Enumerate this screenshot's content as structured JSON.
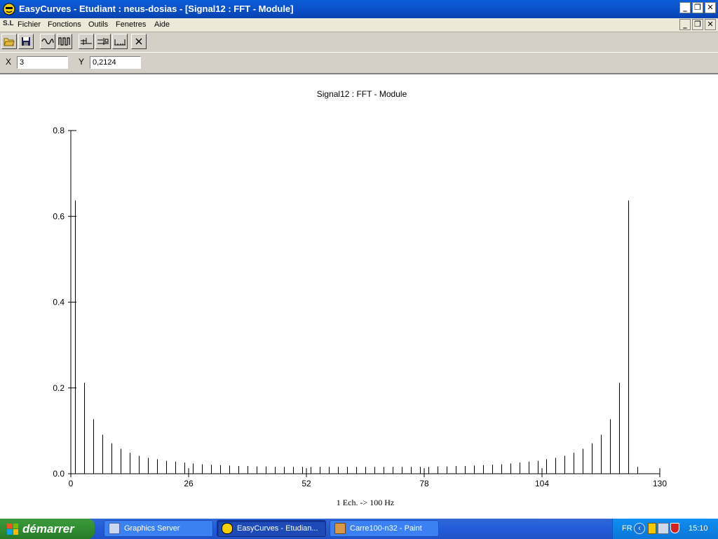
{
  "window": {
    "title": "EasyCurves - Etudiant : neus-dosias - [Signal12 : FFT - Module]",
    "controls": {
      "minimize": "_",
      "restore": "❐",
      "close": "✕"
    }
  },
  "menu": {
    "icon_text": "S.L",
    "items": [
      "Fichier",
      "Fonctions",
      "Outils",
      "Fenetres",
      "Aide"
    ]
  },
  "toolbar": {
    "buttons": [
      "open-folder-icon",
      "save-icon",
      "sine-wave-icon",
      "square-wave-icon",
      "measure-horizontal-icon",
      "measure-cursor-icon",
      "baseline-icon",
      "close-icon"
    ]
  },
  "coords": {
    "x_label": "X",
    "x_value": "3",
    "y_label": "Y",
    "y_value": "0,2124"
  },
  "chart_data": {
    "type": "bar",
    "style": "stem",
    "title": "Signal12 : FFT - Module",
    "xlabel": "1 Ech. -> 100 Hz",
    "ylabel": "",
    "xlim": [
      0,
      130
    ],
    "ylim": [
      0,
      0.8
    ],
    "xticks": [
      0,
      26,
      52,
      78,
      104,
      130
    ],
    "yticks": [
      "0.0",
      "0.2",
      "0.4",
      "0.6",
      "0.8"
    ],
    "x": [
      1,
      3,
      5,
      7,
      9,
      11,
      13,
      15,
      17,
      19,
      21,
      23,
      25,
      27,
      29,
      31,
      33,
      35,
      37,
      39,
      41,
      43,
      45,
      47,
      49,
      51,
      53,
      55,
      57,
      59,
      61,
      63,
      65,
      67,
      69,
      71,
      73,
      75,
      77,
      79,
      81,
      83,
      85,
      87,
      89,
      91,
      93,
      95,
      97,
      99,
      101,
      103,
      105,
      107,
      109,
      111,
      113,
      115,
      117,
      119,
      121,
      123,
      125,
      127,
      129
    ],
    "values": [
      0.637,
      0.212,
      0.127,
      0.091,
      0.071,
      0.058,
      0.049,
      0.042,
      0.037,
      0.034,
      0.03,
      0.028,
      0.026,
      0.024,
      0.022,
      0.021,
      0.02,
      0.019,
      0.018,
      0.018,
      0.017,
      0.017,
      0.016,
      0.016,
      0.016,
      0.016,
      0.016,
      0.016,
      0.016,
      0.016,
      0.016,
      0.016,
      0.016,
      0.016,
      0.016,
      0.016,
      0.016,
      0.016,
      0.016,
      0.016,
      0.017,
      0.017,
      0.018,
      0.018,
      0.019,
      0.02,
      0.021,
      0.022,
      0.024,
      0.026,
      0.028,
      0.03,
      0.034,
      0.037,
      0.042,
      0.049,
      0.058,
      0.071,
      0.091,
      0.127,
      0.212,
      0.637,
      0.016
    ],
    "grid": false,
    "legend": "none"
  },
  "taskbar": {
    "start_label": "démarrer",
    "tasks": [
      {
        "label": "Graphics Server",
        "icon": "graphics-server-icon",
        "active": false
      },
      {
        "label": "EasyCurves - Etudian...",
        "icon": "easycurves-icon",
        "active": true
      },
      {
        "label": "Carre100-n32 - Paint",
        "icon": "paint-icon",
        "active": false
      }
    ],
    "tray": {
      "language": "FR",
      "time": "15:10"
    }
  },
  "colors": {
    "titlebar": "#0a4dc4",
    "taskbar": "#245edb",
    "start": "#2f8a2f",
    "tray": "#0b77d9"
  }
}
